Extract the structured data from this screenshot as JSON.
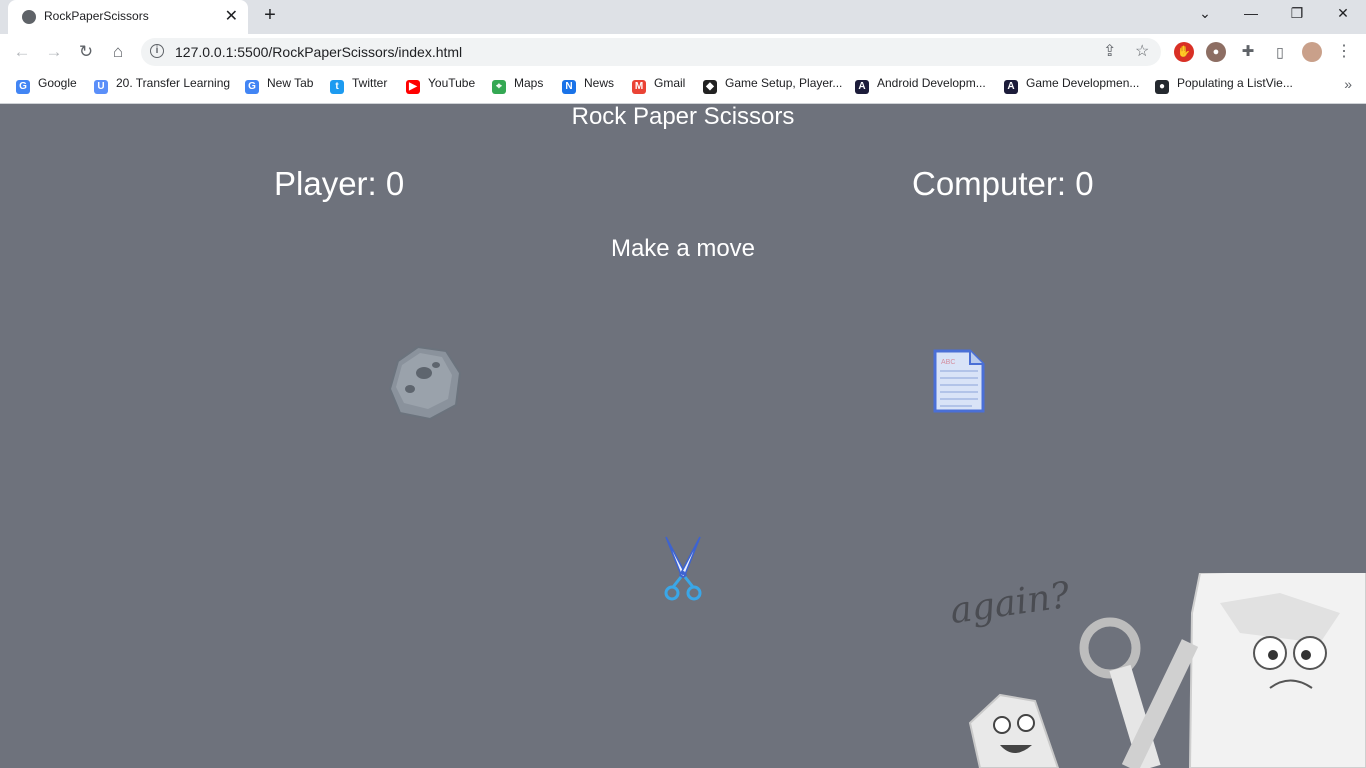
{
  "browser": {
    "tab_title": "RockPaperScissors",
    "url": "127.0.0.1:5500/RockPaperScissors/index.html",
    "bookmarks": [
      {
        "label": "Google",
        "icon": "google-icon"
      },
      {
        "label": "20. Transfer Learning",
        "icon": "udemy-icon"
      },
      {
        "label": "New Tab",
        "icon": "google-icon"
      },
      {
        "label": "Twitter",
        "icon": "twitter-icon"
      },
      {
        "label": "YouTube",
        "icon": "youtube-icon"
      },
      {
        "label": "Maps",
        "icon": "maps-icon"
      },
      {
        "label": "News",
        "icon": "news-icon"
      },
      {
        "label": "Gmail",
        "icon": "gmail-icon"
      },
      {
        "label": "Game Setup, Player...",
        "icon": "unity-icon"
      },
      {
        "label": "Android Developm...",
        "icon": "android-dev-icon"
      },
      {
        "label": "Game Developmen...",
        "icon": "game-dev-icon"
      },
      {
        "label": "Populating a ListVie...",
        "icon": "github-icon"
      }
    ]
  },
  "game": {
    "title": "Rock Paper Scissors",
    "player_score": "Player: 0",
    "computer_score": "Computer: 0",
    "message": "Make a move",
    "moves": [
      "rock",
      "paper",
      "scissors"
    ],
    "art_caption": "again?"
  },
  "colors": {
    "page_background": "#6e727c",
    "text": "#ffffff"
  }
}
